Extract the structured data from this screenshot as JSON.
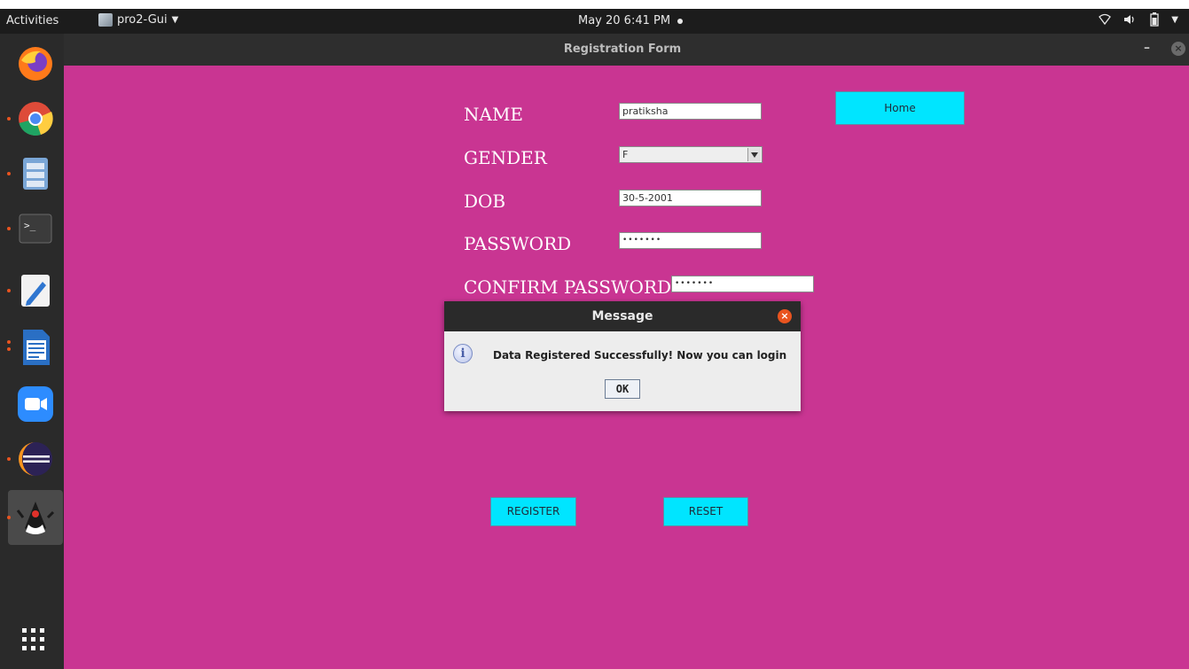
{
  "topbar": {
    "activities": "Activities",
    "app_name": "pro2-Gui",
    "clock": "May 20  6:41 PM"
  },
  "dock": {
    "items": [
      "firefox-icon",
      "chrome-icon",
      "files-icon",
      "terminal-icon",
      "text-editor-icon",
      "writer-icon",
      "zoom-icon",
      "eclipse-icon",
      "java-duke-icon",
      "apps-grid-icon"
    ]
  },
  "window": {
    "title": "Registration Form",
    "minimize": "–",
    "close": "×"
  },
  "form": {
    "name_label": "NAME",
    "name_value": "pratiksha",
    "gender_label": "GENDER",
    "gender_value": "F",
    "dob_label": "DOB",
    "dob_value": "30-5-2001",
    "password_label": "PASSWORD",
    "password_value": "•••••••",
    "confirm_label": "CONFIRM PASSWORD",
    "confirm_value": "•••••••",
    "home_button": "Home",
    "register_button": "REGISTER",
    "reset_button": "RESET"
  },
  "dialog": {
    "title": "Message",
    "message": "Data Registered Successfully! Now you can login",
    "ok_button": "OK"
  },
  "colors": {
    "form_bg": "#c93592",
    "button_bg": "#00e5ff",
    "dialog_close": "#e9541f"
  }
}
